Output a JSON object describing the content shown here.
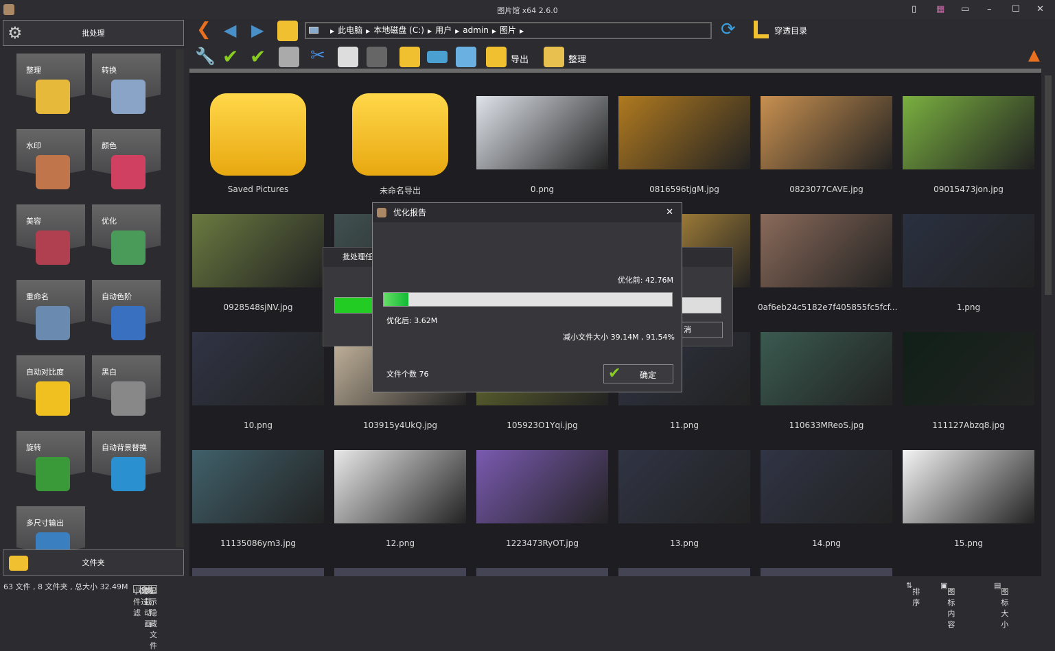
{
  "window": {
    "title": "图片馆 x64 2.6.0"
  },
  "sidebar": {
    "batch_label": "批处理",
    "folder_label": "文件夹",
    "tools": [
      {
        "label": "整理",
        "color": "#e7b93a"
      },
      {
        "label": "转换",
        "color": "#8aa4c8"
      },
      {
        "label": "水印",
        "color": "#c0764a"
      },
      {
        "label": "颜色",
        "color": "#d04060"
      },
      {
        "label": "美容",
        "color": "#b04050"
      },
      {
        "label": "优化",
        "color": "#4a9a5a"
      },
      {
        "label": "重命名",
        "color": "#6a8ab0"
      },
      {
        "label": "自动色阶",
        "color": "#3a70c0"
      },
      {
        "label": "自动对比度",
        "color": "#f0c020"
      },
      {
        "label": "黑白",
        "color": "#888888"
      },
      {
        "label": "旋转",
        "color": "#3a9a3a"
      },
      {
        "label": "自动背景替换",
        "color": "#2a90d0"
      },
      {
        "label": "多尺寸输出",
        "color": "#3a80c0"
      }
    ]
  },
  "nav": {
    "breadcrumb": [
      "此电脑",
      "本地磁盘 (C:)",
      "用户",
      "admin",
      "图片"
    ],
    "traverse_label": "穿透目录"
  },
  "toolbar": {
    "export_label": "导出",
    "organize_label": "整理"
  },
  "files": [
    {
      "name": "Saved Pictures",
      "type": "folder"
    },
    {
      "name": "未命名导出",
      "type": "folder"
    },
    {
      "name": "0.png",
      "color": "#dfe3ea"
    },
    {
      "name": "0816596tjgM.jpg",
      "color": "#b07a20"
    },
    {
      "name": "0823077CAVE.jpg",
      "color": "#c89050"
    },
    {
      "name": "09015473jon.jpg",
      "color": "#7ab040"
    },
    {
      "name": "0928548sjNV.jpg",
      "color": "#6a7a40"
    },
    {
      "name": "",
      "color": "#405050"
    },
    {
      "name": "",
      "color": "#304040"
    },
    {
      "name": "",
      "color": "#d0a040"
    },
    {
      "name": "0af6eb24c5182e7f405855fc5fcf...",
      "color": "#8a6a5a"
    },
    {
      "name": "1.png",
      "color": "#2a3040"
    },
    {
      "name": "10.png",
      "color": "#303444"
    },
    {
      "name": "103915y4UkQ.jpg",
      "color": "#c8b8a0"
    },
    {
      "name": "105923O1Yqi.jpg",
      "color": "#6a7030"
    },
    {
      "name": "11.png",
      "color": "#303444"
    },
    {
      "name": "110633MReoS.jpg",
      "color": "#3a5a50"
    },
    {
      "name": "111127Abzq8.jpg",
      "color": "#102018"
    },
    {
      "name": "11135086ym3.jpg",
      "color": "#40606a"
    },
    {
      "name": "12.png",
      "color": "#e8e8e8"
    },
    {
      "name": "1223473RyOT.jpg",
      "color": "#7a5ab0"
    },
    {
      "name": "13.png",
      "color": "#303444"
    },
    {
      "name": "14.png",
      "color": "#303444"
    },
    {
      "name": "15.png",
      "color": "#f4f4f4"
    }
  ],
  "background_dialog": {
    "title": "批处理任",
    "cancel_partial": "消"
  },
  "report_dialog": {
    "title": "优化报告",
    "before": "优化前: 42.76M",
    "after": "优化后: 3.62M",
    "reduced": "减小文件大小 39.14M , 91.54%",
    "count": "文件个数 76",
    "ok_label": "确定",
    "progress": 0.085
  },
  "status": {
    "summary": "63 文件 , 8 文件夹 , 总大小 32.49M",
    "options": [
      {
        "label": "小文件过滤",
        "checked": false
      },
      {
        "label": "视频",
        "checked": true
      },
      {
        "label": "装载动画",
        "checked": true
      },
      {
        "label": "显示隐藏文件",
        "checked": false
      }
    ],
    "sort_label": "排序",
    "icon_content_label": "图标内容",
    "icon_size_label": "图标大小"
  }
}
